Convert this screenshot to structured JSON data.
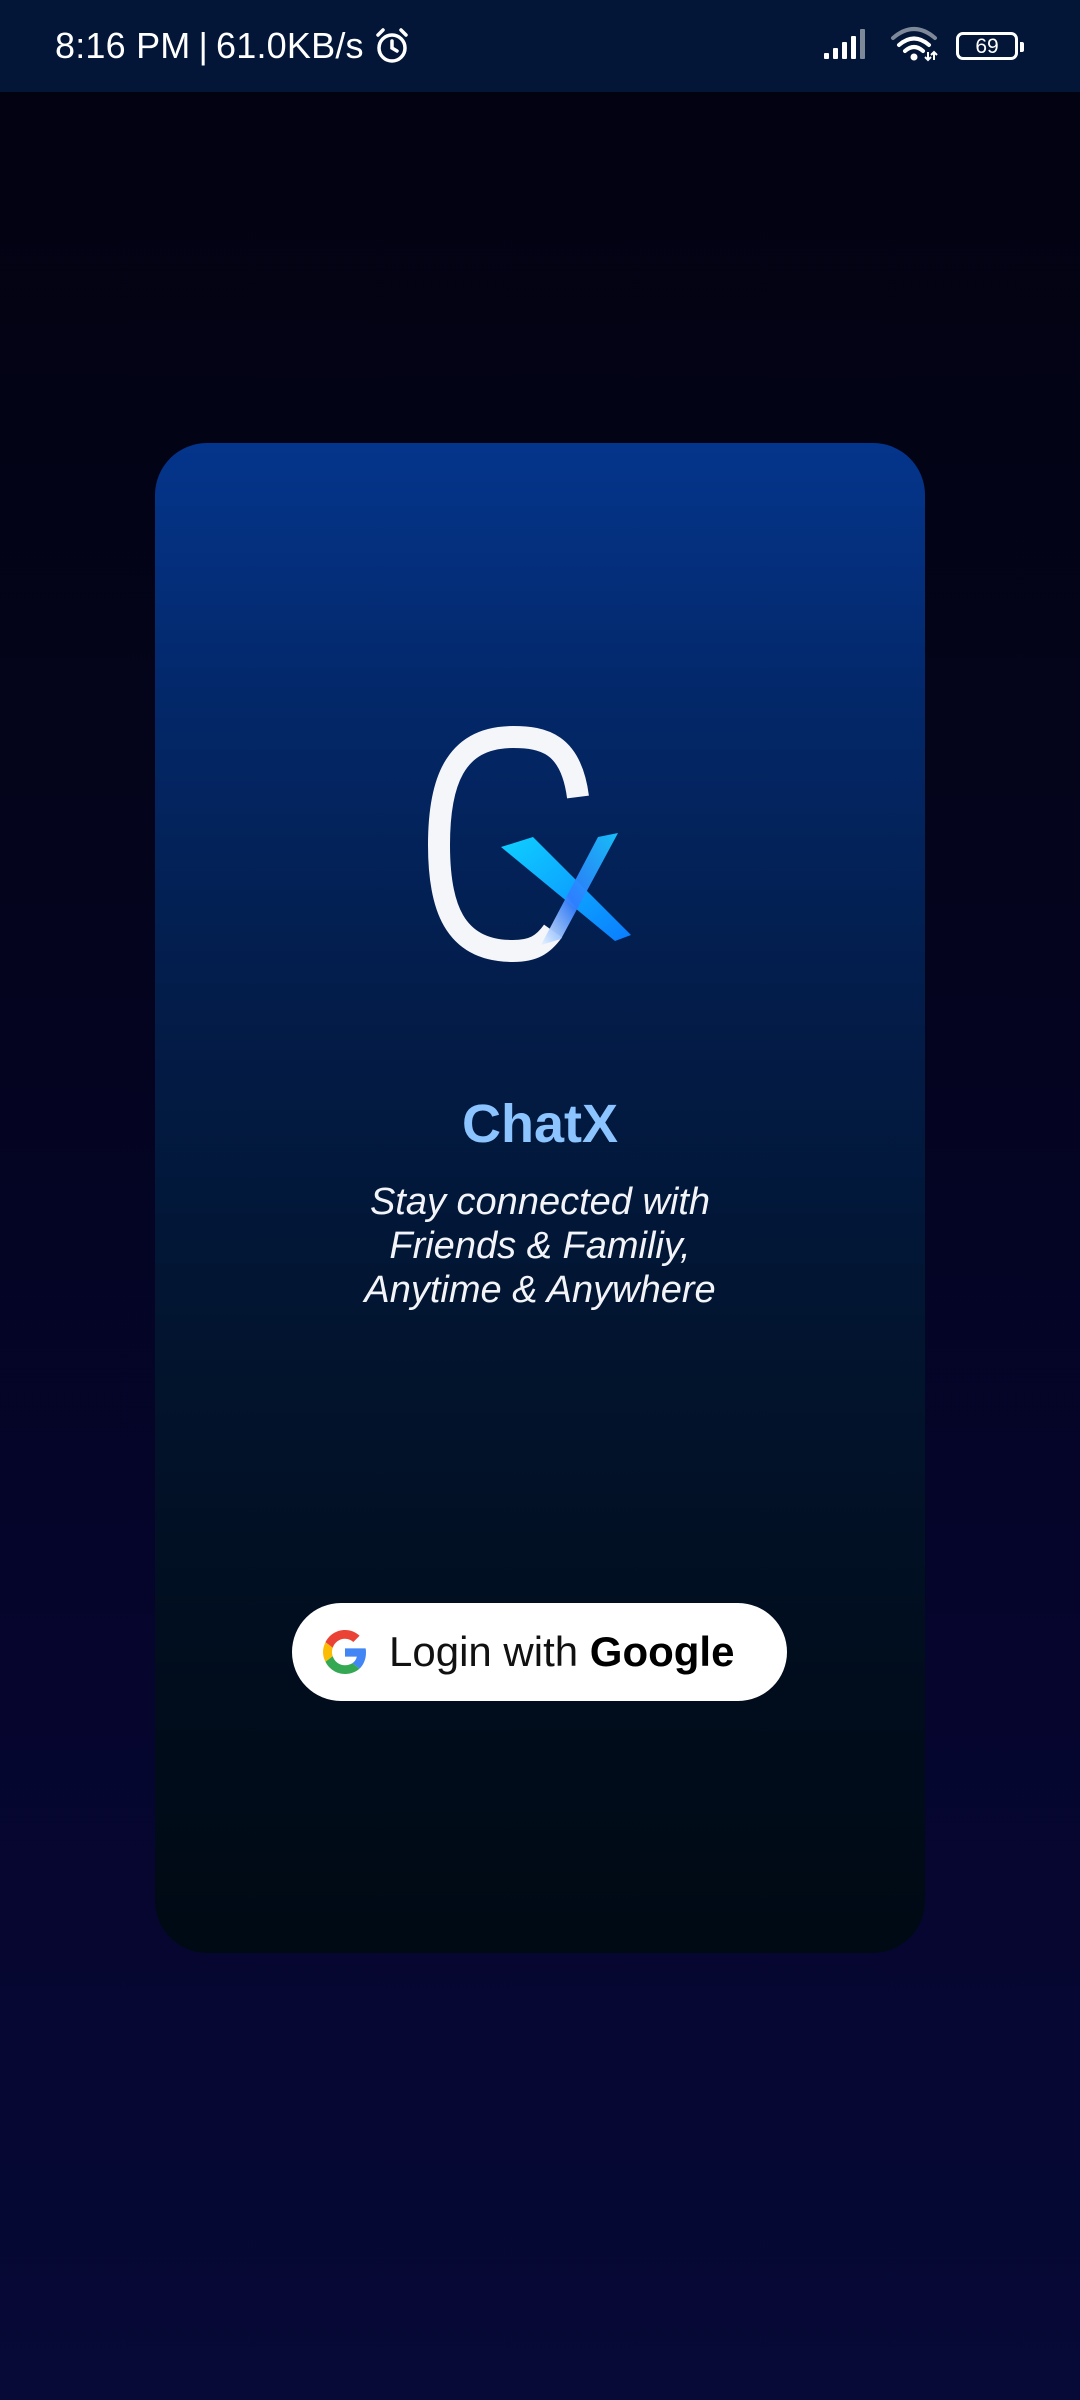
{
  "status_bar": {
    "time": "8:16 PM",
    "separator": "|",
    "network_speed": "61.0KB/s",
    "battery_level": "69",
    "icons": [
      "alarm-icon",
      "signal-icon",
      "wifi-icon",
      "battery-icon"
    ]
  },
  "app": {
    "name": "ChatX",
    "tagline": [
      "Stay connected with",
      "Friends & Familiy,",
      "Anytime & Anywhere"
    ],
    "logo": "chatx-logo"
  },
  "login": {
    "prefix": "Login with",
    "provider": "Google",
    "icon": "google-icon"
  },
  "colors": {
    "status_bar_bg": "#031638",
    "card_top": "#04358c",
    "card_bottom": "#000a14",
    "title": "#8cc4ff",
    "accent_x": "#13b8ff",
    "button_bg": "#ffffff"
  }
}
